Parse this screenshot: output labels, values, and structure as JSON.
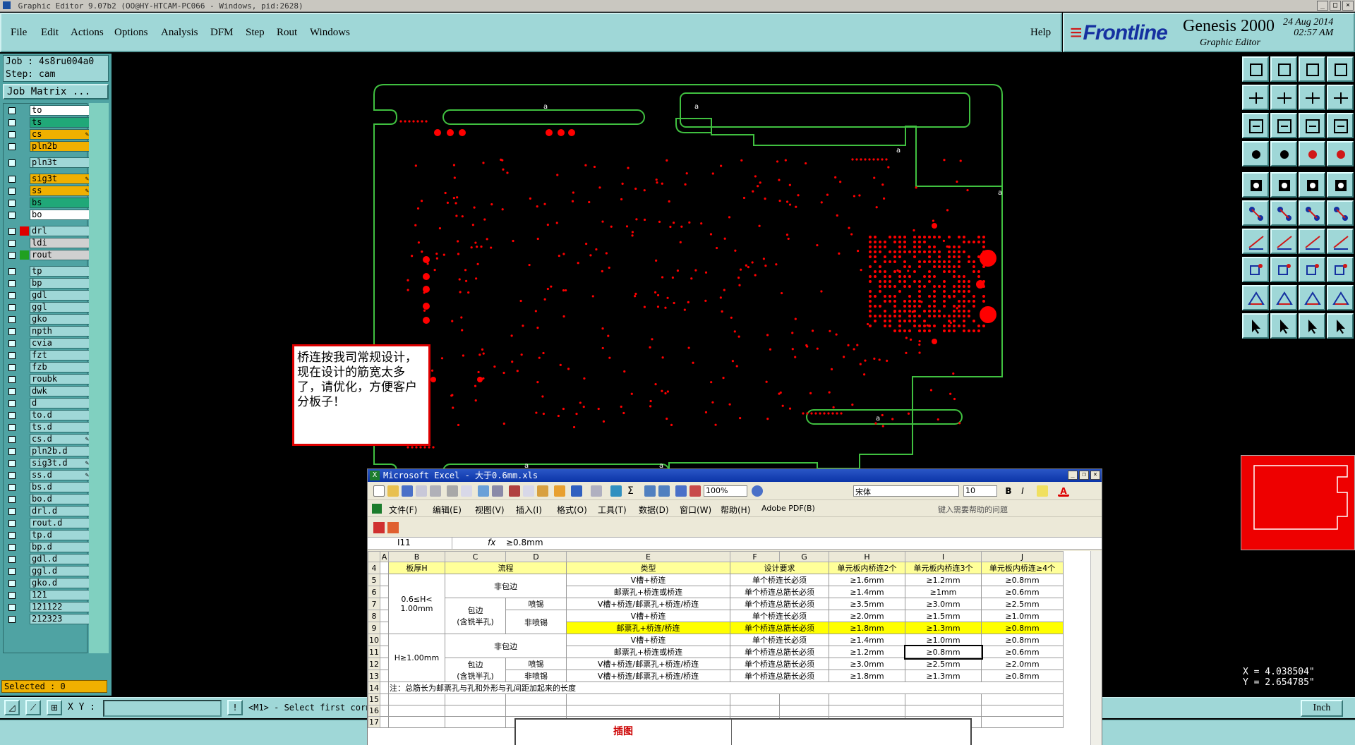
{
  "window": {
    "title": "Graphic Editor 9.07b2 (OO@HY-HTCAM-PC066 - Windows, pid:2628)"
  },
  "menu": {
    "items": [
      "File",
      "Edit",
      "Actions",
      "Options",
      "Analysis",
      "DFM",
      "Step",
      "Rout",
      "Windows"
    ],
    "help": "Help"
  },
  "brand": {
    "logo": "Frontline",
    "product": "Genesis 2000",
    "subtitle": "Graphic Editor",
    "date": "24 Aug 2014",
    "time": "02:57 AM"
  },
  "job": {
    "job_line": "Job : 4s8ru004a0",
    "step_line": "Step: cam",
    "matrix_button": "Job Matrix ..."
  },
  "layers": [
    {
      "name": "to",
      "color": "#ffffff",
      "swatch": "",
      "editable": false
    },
    {
      "name": "ts",
      "color": "#20a878",
      "swatch": "",
      "editable": false
    },
    {
      "name": "cs",
      "color": "#f0b000",
      "swatch": "",
      "editable": true
    },
    {
      "name": "pln2b",
      "color": "#f0b000",
      "swatch": "",
      "editable": false
    },
    {
      "name": "pln3t",
      "color": "#9fd7d7",
      "swatch": "",
      "editable": false
    },
    {
      "name": "sig3t",
      "color": "#f0b000",
      "swatch": "",
      "editable": true
    },
    {
      "name": "ss",
      "color": "#f0b000",
      "swatch": "",
      "editable": true
    },
    {
      "name": "bs",
      "color": "#20a878",
      "swatch": "",
      "editable": false
    },
    {
      "name": "bo",
      "color": "#ffffff",
      "swatch": "",
      "editable": false
    },
    {
      "name": "drl",
      "color": "#9fd7d7",
      "swatch": "#e00000",
      "editable": false
    },
    {
      "name": "ldi",
      "color": "#d0d0d0",
      "swatch": "",
      "editable": false
    },
    {
      "name": "rout",
      "color": "#d0d0d0",
      "swatch": "#20a020",
      "editable": false
    },
    {
      "name": "tp",
      "color": "#9fd7d7",
      "swatch": "",
      "editable": false
    },
    {
      "name": "bp",
      "color": "#9fd7d7",
      "swatch": "",
      "editable": false
    },
    {
      "name": "gdl",
      "color": "#9fd7d7",
      "swatch": "",
      "editable": false
    },
    {
      "name": "ggl",
      "color": "#9fd7d7",
      "swatch": "",
      "editable": false
    },
    {
      "name": "gko",
      "color": "#9fd7d7",
      "swatch": "",
      "editable": false
    },
    {
      "name": "npth",
      "color": "#9fd7d7",
      "swatch": "",
      "editable": false
    },
    {
      "name": "cvia",
      "color": "#9fd7d7",
      "swatch": "",
      "editable": false
    },
    {
      "name": "fzt",
      "color": "#9fd7d7",
      "swatch": "",
      "editable": false
    },
    {
      "name": "fzb",
      "color": "#9fd7d7",
      "swatch": "",
      "editable": false
    },
    {
      "name": "roubk",
      "color": "#9fd7d7",
      "swatch": "",
      "editable": false
    },
    {
      "name": "dwk",
      "color": "#9fd7d7",
      "swatch": "",
      "editable": false
    },
    {
      "name": "d",
      "color": "#9fd7d7",
      "swatch": "",
      "editable": false
    },
    {
      "name": "to.d",
      "color": "#9fd7d7",
      "swatch": "",
      "editable": false
    },
    {
      "name": "ts.d",
      "color": "#9fd7d7",
      "swatch": "",
      "editable": false
    },
    {
      "name": "cs.d",
      "color": "#9fd7d7",
      "swatch": "",
      "editable": true
    },
    {
      "name": "pln2b.d",
      "color": "#9fd7d7",
      "swatch": "",
      "editable": false
    },
    {
      "name": "sig3t.d",
      "color": "#9fd7d7",
      "swatch": "",
      "editable": true
    },
    {
      "name": "ss.d",
      "color": "#9fd7d7",
      "swatch": "",
      "editable": true
    },
    {
      "name": "bs.d",
      "color": "#9fd7d7",
      "swatch": "",
      "editable": false
    },
    {
      "name": "bo.d",
      "color": "#9fd7d7",
      "swatch": "",
      "editable": false
    },
    {
      "name": "drl.d",
      "color": "#9fd7d7",
      "swatch": "",
      "editable": false
    },
    {
      "name": "rout.d",
      "color": "#9fd7d7",
      "swatch": "",
      "editable": false
    },
    {
      "name": "tp.d",
      "color": "#9fd7d7",
      "swatch": "",
      "editable": false
    },
    {
      "name": "bp.d",
      "color": "#9fd7d7",
      "swatch": "",
      "editable": false
    },
    {
      "name": "gdl.d",
      "color": "#9fd7d7",
      "swatch": "",
      "editable": false
    },
    {
      "name": "ggl.d",
      "color": "#9fd7d7",
      "swatch": "",
      "editable": false
    },
    {
      "name": "gko.d",
      "color": "#9fd7d7",
      "swatch": "",
      "editable": false
    },
    {
      "name": "121",
      "color": "#9fd7d7",
      "swatch": "",
      "editable": false
    },
    {
      "name": "121122",
      "color": "#9fd7d7",
      "swatch": "",
      "editable": false
    },
    {
      "name": "212323",
      "color": "#9fd7d7",
      "swatch": "",
      "editable": false
    }
  ],
  "selected_text": "Selected : 0",
  "note": "桥连按我司常规设计，现在设计的筋宽太多了，请优化，方便客户分板子！",
  "coords": {
    "x": "X = 4.038504\"",
    "y": "Y = 2.654785\""
  },
  "bottom": {
    "xy_label": "X Y :",
    "message": "<M1> - Select first corn",
    "units": "Inch"
  },
  "excel": {
    "title": "Microsoft Excel - 大于0.6mm.xls",
    "zoom": "100%",
    "font": "宋体",
    "font_size": "10",
    "menu": [
      "文件(F)",
      "编辑(E)",
      "视图(V)",
      "插入(I)",
      "格式(O)",
      "工具(T)",
      "数据(D)",
      "窗口(W)",
      "帮助(H)",
      "Adobe PDF(B)"
    ],
    "help_placeholder": "键入需要帮助的问题",
    "cell_ref": "I11",
    "fx": "fx",
    "formula": "≥0.8mm",
    "col_headers": [
      "A",
      "B",
      "C",
      "D",
      "E",
      "F",
      "G",
      "H",
      "I",
      "J"
    ],
    "header_row": [
      "板厚H",
      "流程",
      "类型",
      "设计要求",
      "单元板内桥连2个",
      "单元板内桥连3个",
      "单元板内桥连≥4个"
    ],
    "groups": {
      "g1": "0.6≤H<\n1.00mm",
      "g2": "H≥1.00mm",
      "nonwrap": "非包边",
      "wrap": "包边\n(含铣半孔)",
      "spray": "喷锡",
      "nospray": "非喷锡"
    },
    "rows": [
      {
        "n": "5",
        "type": "V槽+桥连",
        "req": "单个桥连长必须",
        "h": "≥1.6mm",
        "i": "≥1.2mm",
        "j": "≥0.8mm"
      },
      {
        "n": "6",
        "type": "邮票孔+桥连或桥连",
        "req": "单个桥连总筋长必须",
        "h": "≥1.4mm",
        "i": "≥1mm",
        "j": "≥0.6mm"
      },
      {
        "n": "7",
        "type": "V槽+桥连/邮票孔+桥连/桥连",
        "req": "单个桥连总筋长必须",
        "h": "≥3.5mm",
        "i": "≥3.0mm",
        "j": "≥2.5mm"
      },
      {
        "n": "8",
        "type": "V槽+桥连",
        "req": "单个桥连长必须",
        "h": "≥2.0mm",
        "i": "≥1.5mm",
        "j": "≥1.0mm"
      },
      {
        "n": "9",
        "type": "邮票孔+桥连/桥连",
        "req": "单个桥连总筋长必须",
        "h": "≥1.8mm",
        "i": "≥1.3mm",
        "j": "≥0.8mm"
      },
      {
        "n": "10",
        "type": "V槽+桥连",
        "req": "单个桥连长必须",
        "h": "≥1.4mm",
        "i": "≥1.0mm",
        "j": "≥0.8mm"
      },
      {
        "n": "11",
        "type": "邮票孔+桥连或桥连",
        "req": "单个桥连总筋长必须",
        "h": "≥1.2mm",
        "i": "≥0.8mm",
        "j": "≥0.6mm"
      },
      {
        "n": "12",
        "type": "V槽+桥连/邮票孔+桥连/桥连",
        "req": "单个桥连总筋长必须",
        "h": "≥3.0mm",
        "i": "≥2.5mm",
        "j": "≥2.0mm"
      },
      {
        "n": "13",
        "type": "V槽+桥连/邮票孔+桥连/桥连",
        "req": "单个桥连总筋长必须",
        "h": "≥1.8mm",
        "i": "≥1.3mm",
        "j": "≥0.8mm"
      }
    ],
    "footnote": "注：总筋长为邮票孔与孔和外形与孔间距加起来的长度",
    "row_nums": [
      "4",
      "5",
      "6",
      "7",
      "8",
      "9",
      "10",
      "11",
      "12",
      "13",
      "14",
      "15",
      "16",
      "17"
    ],
    "chart_label": "插图"
  },
  "colors": {
    "accent_teal": "#9fd7d7",
    "drill_red": "#ff0000",
    "rout_green": "#40c040",
    "highlight": "#ffff00"
  }
}
